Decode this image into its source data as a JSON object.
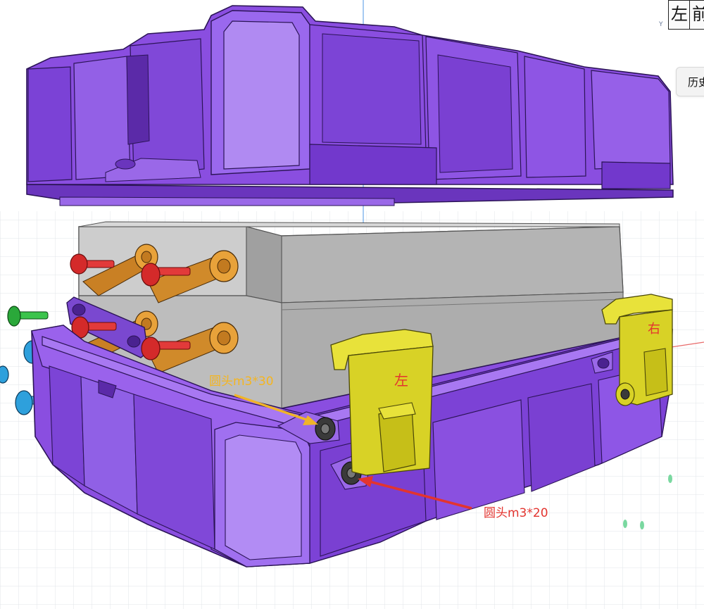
{
  "viewcube": {
    "left_face": "左",
    "front_face": "前",
    "axis_label": "Y"
  },
  "toolbar": {
    "history_label": "历史"
  },
  "annotations": {
    "screw_30": "圆头m3*30",
    "screw_20": "圆头m3*20"
  },
  "parts": {
    "left_latch_label": "左",
    "right_latch_label": "右"
  },
  "colors": {
    "case_purple": "#8a4ee0",
    "case_dark": "#5b2aa8",
    "latch_yellow": "#d8d226",
    "hinge_orange": "#e09a2e",
    "screw_red": "#d42a2a",
    "screw_blue": "#2ea0dc",
    "screw_green": "#2aa83a",
    "box_grey": "#b4b4b4",
    "annotation_yellow": "#f0b429",
    "annotation_red": "#e3342f"
  }
}
